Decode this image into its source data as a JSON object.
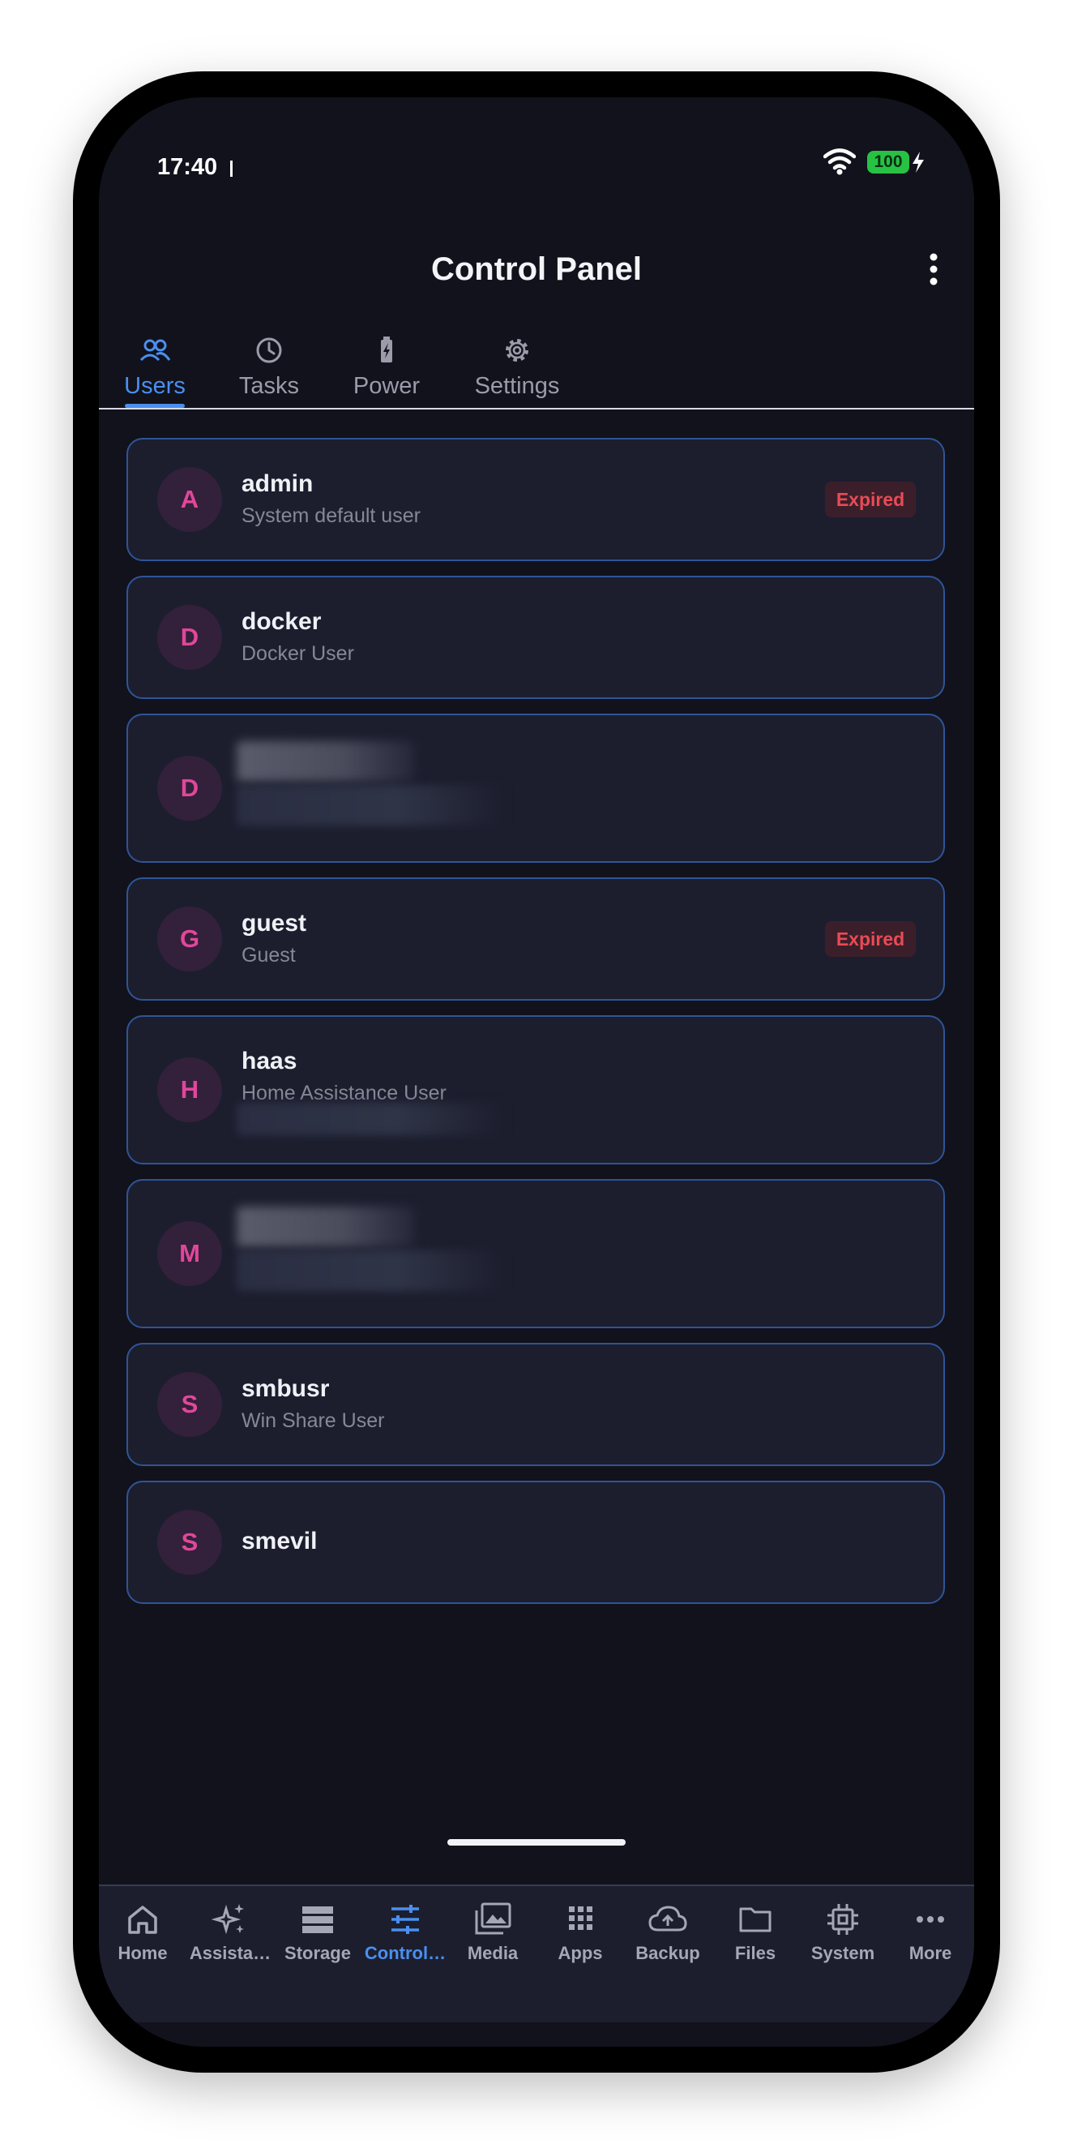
{
  "status_bar": {
    "time": "17:40",
    "battery": "100"
  },
  "header": {
    "title": "Control Panel"
  },
  "tabs": [
    {
      "label": "Users",
      "icon": "users-icon",
      "active": true
    },
    {
      "label": "Tasks",
      "icon": "clock-icon",
      "active": false
    },
    {
      "label": "Power",
      "icon": "battery-charging-icon",
      "active": false
    },
    {
      "label": "Settings",
      "icon": "gear-icon",
      "active": false
    }
  ],
  "users": [
    {
      "initial": "A",
      "name": "admin",
      "description": "System default user",
      "badge": "Expired"
    },
    {
      "initial": "D",
      "name": "docker",
      "description": "Docker User"
    },
    {
      "initial": "D",
      "redacted": true
    },
    {
      "initial": "G",
      "name": "guest",
      "description": "Guest",
      "badge": "Expired"
    },
    {
      "initial": "H",
      "name": "haas",
      "description": "Home Assistance User",
      "redacted": true
    },
    {
      "initial": "M",
      "redacted": true
    },
    {
      "initial": "S",
      "name": "smbusr",
      "description": "Win Share User"
    },
    {
      "initial": "S",
      "name": "smevil"
    }
  ],
  "bottom_nav": [
    {
      "label": "Home",
      "icon": "home-icon"
    },
    {
      "label": "Assista…",
      "icon": "sparkles-icon"
    },
    {
      "label": "Storage",
      "icon": "storage-icon"
    },
    {
      "label": "Control…",
      "icon": "sliders-icon",
      "active": true
    },
    {
      "label": "Media",
      "icon": "photo-library-icon"
    },
    {
      "label": "Apps",
      "icon": "apps-grid-icon"
    },
    {
      "label": "Backup",
      "icon": "cloud-upload-icon"
    },
    {
      "label": "Files",
      "icon": "folder-icon"
    },
    {
      "label": "System",
      "icon": "chip-icon"
    },
    {
      "label": "More",
      "icon": "more-horiz-icon"
    }
  ],
  "colors": {
    "background": "#11121b",
    "card": "#1c1e2e",
    "card_border": "#2f5497",
    "accent": "#4a8ff0",
    "avatar_text": "#e0479a",
    "expired": "#ea4a55"
  }
}
